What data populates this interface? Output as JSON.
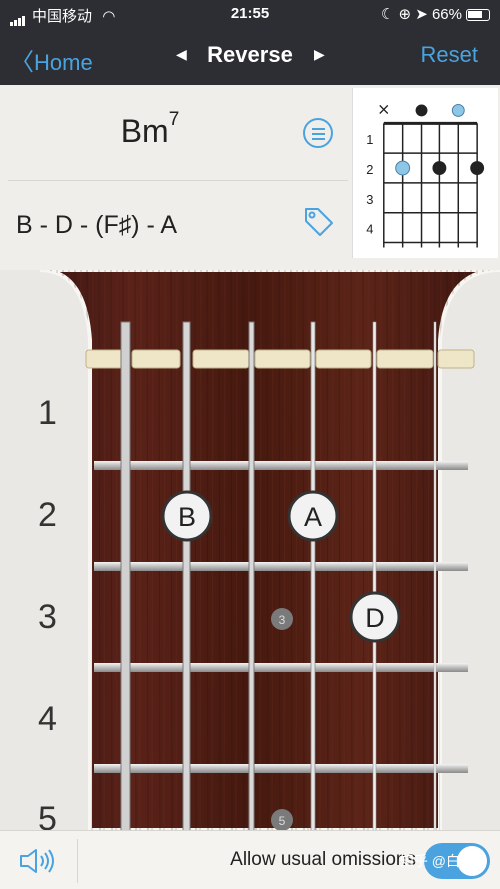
{
  "status_bar": {
    "carrier": "中国移动",
    "time": "21:55",
    "battery": "66%"
  },
  "nav": {
    "back_label": "Home",
    "title": "Reverse",
    "reset_label": "Reset"
  },
  "chord": {
    "root": "Bm",
    "extension": "7",
    "notes": "B - D - (F♯) - A"
  },
  "diagram": {
    "fret_labels": [
      "1",
      "2",
      "3",
      "4"
    ],
    "top_markers": [
      "×",
      "",
      "",
      "",
      "",
      ""
    ],
    "colors": {
      "highlight": "#8ec6e8",
      "dot": "#222222"
    }
  },
  "fretboard": {
    "fret_numbers": [
      "1",
      "2",
      "3",
      "4",
      "5"
    ],
    "notes": [
      {
        "label": "B",
        "string": 2,
        "fret": 2
      },
      {
        "label": "A",
        "string": 4,
        "fret": 2
      },
      {
        "label": "D",
        "string": 5,
        "fret": 3
      }
    ],
    "inlays": [
      "3",
      "5"
    ]
  },
  "bottom": {
    "omissions_label": "Allow usual omissions",
    "toggle_on": true,
    "watermark": "知乎 @白白白"
  },
  "colors": {
    "accent": "#4aa3df",
    "bar": "#2c2e33",
    "wood": "#4a1c16"
  }
}
